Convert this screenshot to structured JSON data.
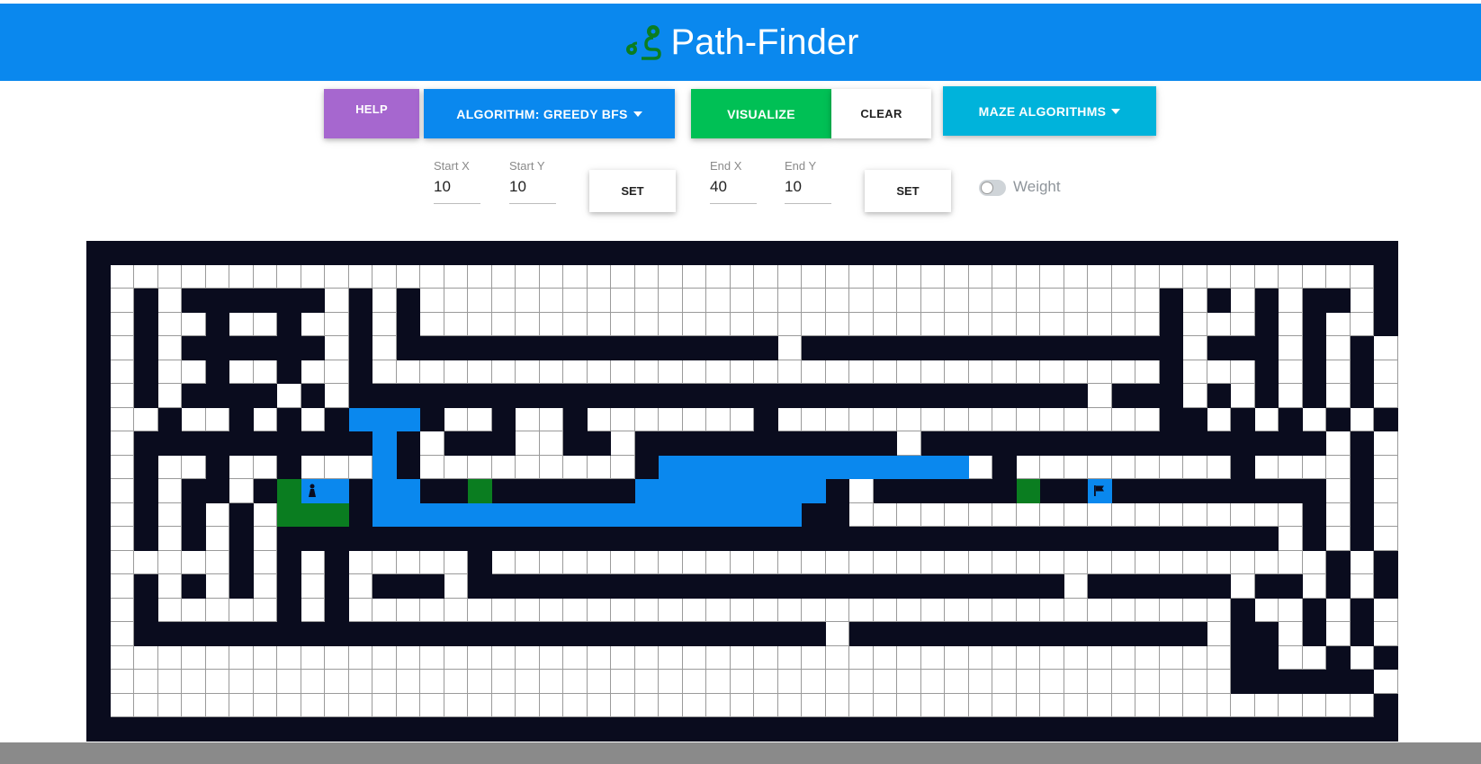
{
  "app": {
    "title": "Path-Finder",
    "logo_icon": "route-pin-icon"
  },
  "toolbar": {
    "help_label": "HELP",
    "algorithm_label": "ALGORITHM: GREEDY BFS",
    "visualize_label": "VISUALIZE",
    "clear_label": "CLEAR",
    "maze_label": "MAZE ALGORITHMS"
  },
  "controls": {
    "start_x": {
      "label": "Start X",
      "value": "10"
    },
    "start_y": {
      "label": "Start Y",
      "value": "10"
    },
    "set_start_label": "SET",
    "end_x": {
      "label": "End X",
      "value": "40"
    },
    "end_y": {
      "label": "End Y",
      "value": "10"
    },
    "set_end_label": "SET",
    "weight_label": "Weight",
    "weight_enabled": false
  },
  "colors": {
    "header": "#0a88ee",
    "help": "#a667cf",
    "algorithm": "#0a88ee",
    "visualize": "#00c055",
    "maze": "#00b3db",
    "wall": "#0a0c1e",
    "path": "#0a88ee",
    "weight": "#0a7d20"
  },
  "grid": {
    "columns": 55,
    "rows": 21,
    "start": [
      10,
      10
    ],
    "end": [
      40,
      10
    ],
    "legend": {
      "#": "wall",
      "P": "path",
      "W": "weight",
      "S": "start",
      "E": "end",
      ".": "empty"
    },
    "cells": [
      "#######################################################",
      "#.....................................................#",
      "#.#.######.#.#...............................#.#.#.##.#",
      "#.#..#..#..#.#...............................#...#.#..#",
      "#.#.######.#.################.################.###.#.#.#",
      "#.#..#..#..#.................................#...#.#.#.#",
      "#.#.####.#.###############################.###.#.#.#.#.#",
      "#..#..#.#.#PPP#..#..#.......#................##.#.#.#.#",
      "#.##########P#.###..##.###########.#################.#",
      "#.#..#..#...P#.........#PPPPPPPPPPPPP.#.........#....#",
      "#.#.##.#WSP#PP##W######PPPPPPPP#.######W##E#########.#",
      "#.#.#.#.WWW#PPPPPPPPPPPPPPPPPP##...................#.#",
      "#.#.#.#.##########################################.#.#",
      "#.....#.#.#.....#...................................#.#",
      "#.#.#.#.#.#.###.#########################.######.##.#.#",
      "#.#.....#.#.....................................#..#.#",
      "#.#############################.###############.##.#.#",
      "#...............................................##..#.#",
      "#...............................................######",
      "#.....................................................#",
      "#######################################################"
    ]
  }
}
